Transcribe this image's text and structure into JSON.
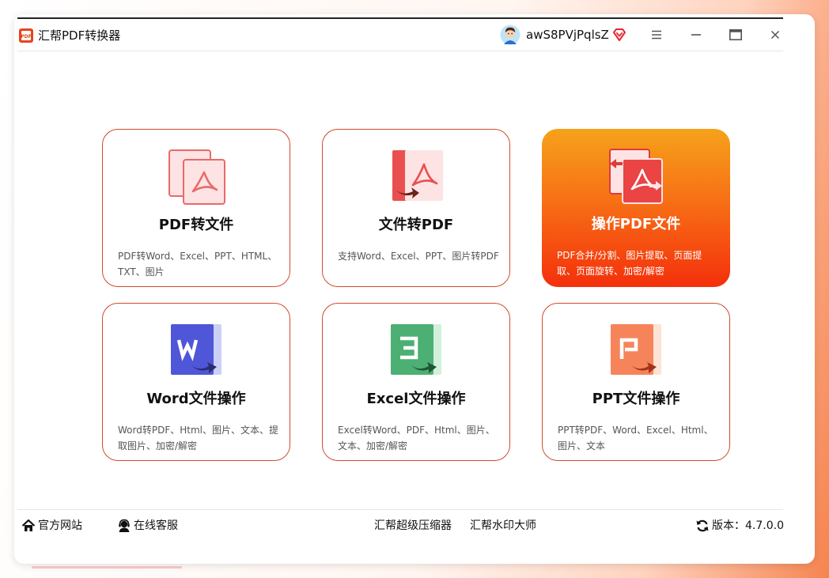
{
  "app": {
    "title": "汇帮PDF转换器",
    "logo_text": "PDF",
    "username": "awS8PVjPqlsZ"
  },
  "colors": {
    "accent": "#cf4b2c",
    "active_gradient_top": "#f6a21a",
    "active_gradient_bottom": "#f4300c",
    "word_blue": "#4f56d8",
    "excel_green": "#4caf73",
    "ppt_orange": "#f6845a",
    "pdf_red": "#e85a5a"
  },
  "cards": [
    {
      "title": "PDF转文件",
      "desc": "PDF转Word、Excel、PPT、HTML、TXT、图片",
      "icon": "pdf-to-file-icon"
    },
    {
      "title": "文件转PDF",
      "desc": "支持Word、Excel、PPT、图片转PDF",
      "icon": "file-to-pdf-icon"
    },
    {
      "title": "操作PDF文件",
      "desc": "PDF合并/分割、图片提取、页面提取、页面旋转、加密/解密",
      "icon": "pdf-operate-icon",
      "active": true
    },
    {
      "title": "Word文件操作",
      "desc": "Word转PDF、Html、图片、文本、提取图片、加密/解密",
      "icon": "word-icon"
    },
    {
      "title": "Excel文件操作",
      "desc": "Excel转Word、PDF、Html、图片、文本、加密/解密",
      "icon": "excel-icon"
    },
    {
      "title": "PPT文件操作",
      "desc": "PPT转PDF、Word、Excel、Html、图片、文本",
      "icon": "ppt-icon"
    }
  ],
  "footer": {
    "site": "官方网站",
    "service": "在线客服",
    "compress": "汇帮超级压缩器",
    "watermark": "汇帮水印大师",
    "version": "版本：4.7.0.0"
  }
}
